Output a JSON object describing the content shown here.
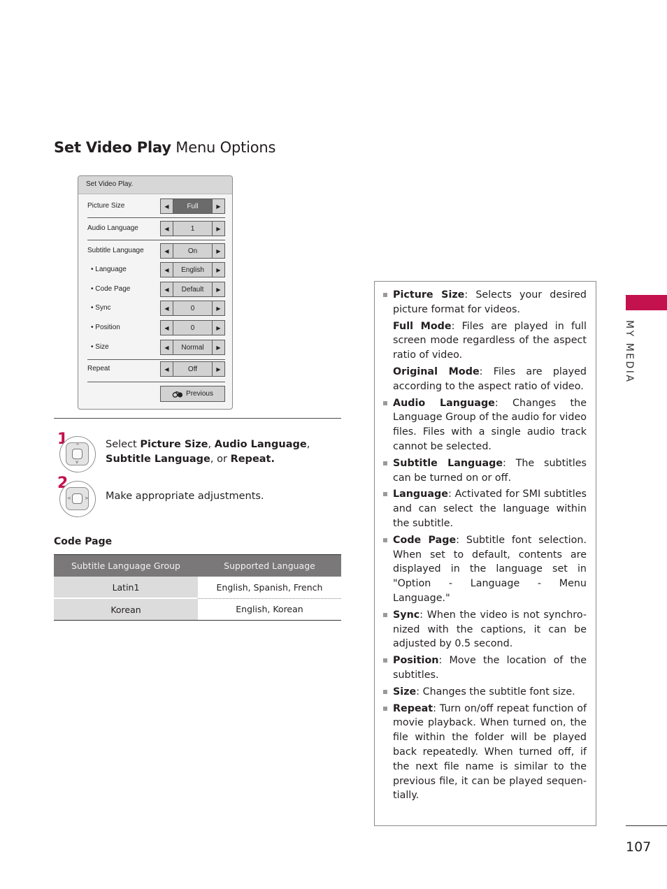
{
  "title": {
    "bold": "Set Video Play",
    "regular": " Menu Options"
  },
  "osd": {
    "title": "Set Video Play.",
    "rows": [
      {
        "label": "Picture Size",
        "value": "Full",
        "selected": true,
        "sub": false
      },
      {
        "label": "Audio Language",
        "value": "1",
        "selected": false,
        "sub": false
      },
      {
        "label": "Subtitle Language",
        "value": "On",
        "selected": false,
        "sub": false
      },
      {
        "label": "• Language",
        "value": "English",
        "selected": false,
        "sub": true
      },
      {
        "label": "• Code Page",
        "value": "Default",
        "selected": false,
        "sub": true
      },
      {
        "label": "• Sync",
        "value": "0",
        "selected": false,
        "sub": true
      },
      {
        "label": "• Position",
        "value": "0",
        "selected": false,
        "sub": true
      },
      {
        "label": "• Size",
        "value": "Normal",
        "selected": false,
        "sub": true
      },
      {
        "label": "Repeat",
        "value": "Off",
        "selected": false,
        "sub": false
      }
    ],
    "left_arrow": "◀",
    "right_arrow": "▶",
    "previous_label": "Previous",
    "previous_icon": "return-icon"
  },
  "steps": [
    {
      "number": "1",
      "icon": "remote-up-down-icon",
      "parts": [
        {
          "text": "Select ",
          "bold": false
        },
        {
          "text": "Picture Size",
          "bold": true
        },
        {
          "text": ", ",
          "bold": false
        },
        {
          "text": "Audio Language",
          "bold": true
        },
        {
          "text": ",",
          "bold": false
        }
      ],
      "parts2": [
        {
          "text": "Subtitle Language",
          "bold": true
        },
        {
          "text": ", or ",
          "bold": false
        },
        {
          "text": "Repeat.",
          "bold": true
        }
      ]
    },
    {
      "number": "2",
      "icon": "remote-left-right-icon",
      "text": "Make appropriate adjustments."
    }
  ],
  "code_page": {
    "heading": "Code Page",
    "columns": [
      "Subtitle Language Group",
      "Supported Language"
    ],
    "rows": [
      [
        "Latin1",
        "English, Spanish, French"
      ],
      [
        "Korean",
        "English, Korean"
      ]
    ]
  },
  "descriptions": [
    {
      "term": "Picture Size",
      "text": ": Selects your desired picture format for videos.",
      "subs": [
        {
          "term": "Full Mode",
          "text": ": Files are played in full screen mode regardless of the aspect ratio of video."
        },
        {
          "term": "Original Mode",
          "text": ": Files are played according to the aspect ratio of video."
        }
      ]
    },
    {
      "term": "Audio Language",
      "text": ": Changes the Language Group of the audio for video files. Files with a single audio track cannot be selected."
    },
    {
      "term": "Subtitle Language",
      "text": ": The subtitles can be turned on or off."
    },
    {
      "term": "Language",
      "text": ": Activated for SMI subtitles and can select the language within the subtitle."
    },
    {
      "term": "Code Page",
      "text": ": Subtitle font selection. When set to default, contents are displayed in the language set in \"Option - Language - Menu Language.\""
    },
    {
      "term": "Sync",
      "text": ": When the video is not synchro-nized with the captions, it can be adjusted by 0.5 second."
    },
    {
      "term": "Position",
      "text": ": Move the location of the subtitles."
    },
    {
      "term": "Size",
      "text": ": Changes the subtitle font size."
    },
    {
      "term": "Repeat",
      "text": ": Turn on/off repeat function of movie playback. When turned on, the file within the folder will be played back repeatedly. When turned off, if the next file name is similar to the previous file, it can be played sequen-tially."
    }
  ],
  "side_tab": {
    "label": "MY MEDIA",
    "color": "#c4124e"
  },
  "page_number": "107"
}
